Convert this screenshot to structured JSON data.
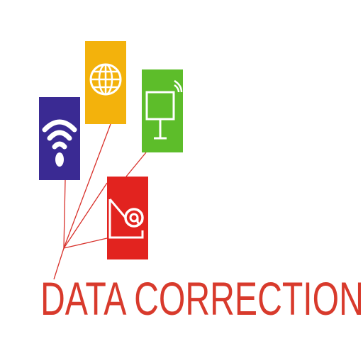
{
  "logo": {
    "title": "DATA CORRECTION",
    "colors": {
      "wifi_tile": "#3a2a93",
      "globe_tile": "#f3b20c",
      "screen_tile": "#5dbd2a",
      "mail_tile": "#e2231f",
      "connector": "#d8302a",
      "title_text": "#d83a2c"
    },
    "icons": [
      "wifi-icon",
      "globe-icon",
      "monitor-icon",
      "email-icon"
    ]
  }
}
